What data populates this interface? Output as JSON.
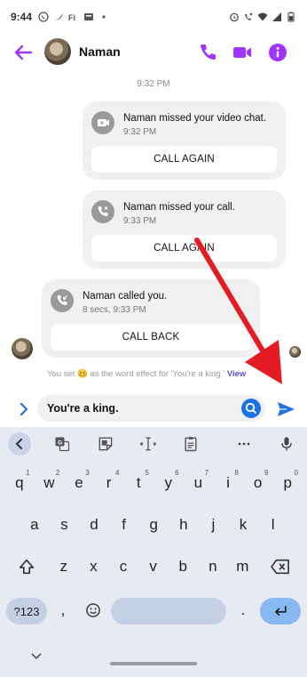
{
  "status_bar": {
    "time": "9:44"
  },
  "header": {
    "contact_name": "Naman"
  },
  "chat": {
    "timestamp": "9:32 PM",
    "cards": [
      {
        "title": "Naman missed your video chat.",
        "subtitle": "9:32 PM",
        "button": "CALL AGAIN"
      },
      {
        "title": "Naman missed your call.",
        "subtitle": "9:33 PM",
        "button": "CALL AGAIN"
      },
      {
        "title": "Naman called you.",
        "subtitle": "8 secs, 9:33 PM",
        "button": "CALL BACK"
      }
    ],
    "effect_note": {
      "prefix": "You set 🥴 as the word effect for 'You're a king.'",
      "link": "View"
    }
  },
  "composer": {
    "text": "You're a king."
  },
  "keyboard": {
    "row1": [
      {
        "k": "q",
        "h": "1"
      },
      {
        "k": "w",
        "h": "2"
      },
      {
        "k": "e",
        "h": "3"
      },
      {
        "k": "r",
        "h": "4"
      },
      {
        "k": "t",
        "h": "5"
      },
      {
        "k": "y",
        "h": "6"
      },
      {
        "k": "u",
        "h": "7"
      },
      {
        "k": "i",
        "h": "8"
      },
      {
        "k": "o",
        "h": "9"
      },
      {
        "k": "p",
        "h": "0"
      }
    ],
    "row2": [
      "a",
      "s",
      "d",
      "f",
      "g",
      "h",
      "j",
      "k",
      "l"
    ],
    "row3": [
      "z",
      "x",
      "c",
      "v",
      "b",
      "n",
      "m"
    ],
    "symbols_label": "?123",
    "comma": ",",
    "period": "."
  },
  "colors": {
    "accent": "#a033ff",
    "send_blue": "#1d72e8",
    "annotation_red": "#e41b23"
  }
}
